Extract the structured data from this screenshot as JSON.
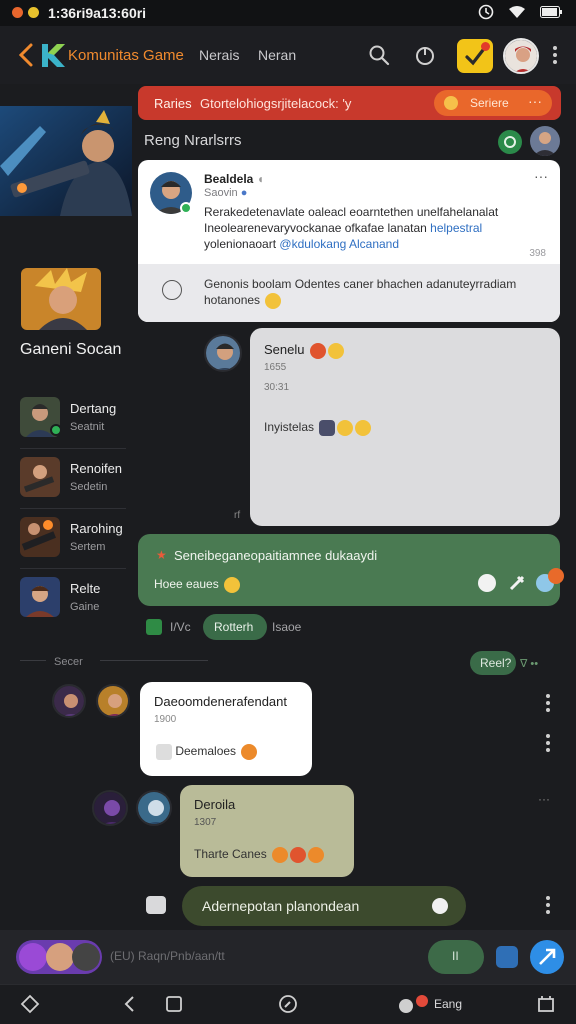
{
  "status_bar": {
    "time": "1:36ri9a13:60ri",
    "dot_colors": [
      "#e8662d",
      "#e8c22d"
    ]
  },
  "header": {
    "title": "Komunitas Game",
    "nav": [
      "Nerais",
      "Neran"
    ],
    "icons": [
      "back-arrow-icon",
      "search-icon",
      "power-icon",
      "check-badge-icon",
      "profile-avatar"
    ]
  },
  "banner": {
    "label": "Raries",
    "text": "Gtortelohiogsrjitelacock: 'y",
    "pill_label": "Seriere",
    "pill_more": "···"
  },
  "section": {
    "title": "Reng Nrarlsrrs"
  },
  "post": {
    "author": "Bealdela",
    "author_badge": "◖",
    "meta": "Saovin",
    "meta_badge": "●",
    "body": "Rerakedetenavlate oaleacl eoarntethen unelfahelanalat Ineolearenevaryvockanae ofkafae lanatan",
    "body_link_1": "helpestral",
    "body_tail": "yolenionaoart",
    "body_link_2": "@kdulokang Alcanand",
    "count": "398",
    "reply_text": "Genonis boolam Odentes caner bhachen adanuteyrradiam hotanones"
  },
  "sidebar": {
    "game_title": "Ganeni Socan",
    "items": [
      {
        "name": "Dertang",
        "sub": "Seatnit"
      },
      {
        "name": "Renoifen",
        "sub": "Sedetin"
      },
      {
        "name": "Rarohing",
        "sub": "Sertem"
      },
      {
        "name": "Relte",
        "sub": "Gaine"
      }
    ]
  },
  "messages": {
    "first": {
      "name": "Senelu",
      "ts1": "1655",
      "ts2": "30:31",
      "line": "Inyistelas",
      "stamp": "rf"
    },
    "green": {
      "title": "Seneibeganeopaitiamnee dukaaydi",
      "sub": "Hoee eaues"
    },
    "reactions": {
      "label": "I/Vc",
      "pill": "Rotterh",
      "after": "Isaoe"
    },
    "divider": {
      "label": "Secer"
    },
    "status_pill": {
      "label": "Reel?",
      "extra": "∇ ••"
    },
    "third": {
      "name": "Daeoomdenerafendant",
      "ts": "1900",
      "line": "Deemaloes"
    },
    "fourth": {
      "name": "Deroila",
      "ts": "1307",
      "line": "Tharte Canes"
    },
    "composer_inline": "Adernepotan planondean"
  },
  "input": {
    "placeholder": "(EU) Raqn/Pnb/aan/tt",
    "mic_label": "II"
  },
  "bottom_nav": {
    "label": "Eang"
  },
  "colors": {
    "accent": "#f08a2e",
    "banner": "#c8392c",
    "green": "#4a7a52",
    "send": "#2e8ee6"
  }
}
